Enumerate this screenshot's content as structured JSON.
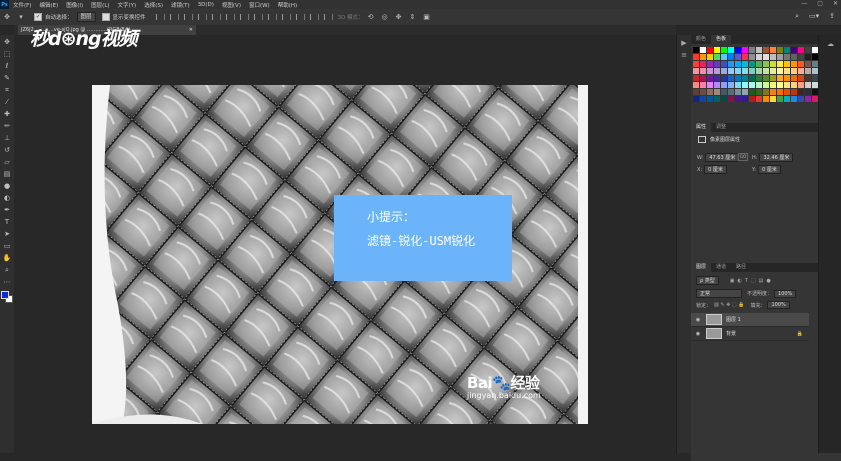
{
  "app": {
    "logo": "Ps"
  },
  "menu": [
    "文件(F)",
    "编辑(E)",
    "图像(I)",
    "图层(L)",
    "文字(Y)",
    "选择(S)",
    "滤镜(T)",
    "3D(D)",
    "视图(V)",
    "窗口(W)",
    "帮助(H)"
  ],
  "window_controls": [
    "—",
    "▢",
    "✕"
  ],
  "options": {
    "auto_select_label": "自动选择：",
    "auto_select_value": "图层",
    "show_transform_label": "显示变换控件",
    "mode_3d_label": "3D 模式："
  },
  "document": {
    "tab_label": "JZ6J2…………ve-sjQ.jpg @ …………(RGB/8#)",
    "close": "✕",
    "add": "+"
  },
  "watermark": "秒d⊛ng视频",
  "tip": {
    "title": "小提示：",
    "body": "滤镜-锐化-USM锐化"
  },
  "baidu_watermark": {
    "main": "Bai🐾经验",
    "sub": "jingyan.baidu.com"
  },
  "swatches_panel": {
    "tabs": [
      "颜色",
      "色板"
    ]
  },
  "properties_panel": {
    "tabs": [
      "属性",
      "调整"
    ],
    "heading": "像素图层属性",
    "w_label": "W:",
    "w_value": "47.63 厘米",
    "h_label": "H:",
    "h_value": "32.46 厘米",
    "link": "GO",
    "x_label": "X:",
    "x_value": "0 厘米",
    "y_label": "Y:",
    "y_value": "0 厘米"
  },
  "layers_panel": {
    "tabs": [
      "图层",
      "通道",
      "路径"
    ],
    "filter_value": "ρ 类型",
    "blend_mode": "正常",
    "opacity_label": "不透明度：",
    "opacity_value": "100%",
    "lock_label": "锁定：",
    "fill_label": "填充：",
    "fill_value": "100%",
    "layers": [
      {
        "name": "图层 1",
        "selected": true
      },
      {
        "name": "背景",
        "selected": false
      }
    ]
  },
  "swatch_colors": [
    "#000000",
    "#ffffff",
    "#ff0000",
    "#ffff00",
    "#00ff00",
    "#00ffff",
    "#0000ff",
    "#ff00ff",
    "#7f7f7f",
    "#c0c0c0",
    "#a0522d",
    "#ff8040",
    "#808000",
    "#008080",
    "#400080",
    "#ff0080",
    "#404040",
    "#ffffff",
    "#ff3b30",
    "#ff9500",
    "#ffcc00",
    "#4cd964",
    "#5ac8fa",
    "#007aff",
    "#5856d6",
    "#ff2d55",
    "#8e8e93",
    "#d1d1d6",
    "#e0e0e0",
    "#bdbdbd",
    "#9e9e9e",
    "#757575",
    "#616161",
    "#424242",
    "#212121",
    "#000000",
    "#f44336",
    "#e91e63",
    "#9c27b0",
    "#673ab7",
    "#3f51b5",
    "#2196f3",
    "#03a9f4",
    "#00bcd4",
    "#009688",
    "#4caf50",
    "#8bc34a",
    "#cddc39",
    "#ffeb3b",
    "#ffc107",
    "#ff9800",
    "#ff5722",
    "#795548",
    "#607d8b",
    "#ef9a9a",
    "#f48fb1",
    "#ce93d8",
    "#b39ddb",
    "#9fa8da",
    "#90caf9",
    "#81d4fa",
    "#80deea",
    "#80cbc4",
    "#a5d6a7",
    "#c5e1a5",
    "#e6ee9c",
    "#fff59d",
    "#ffe082",
    "#ffcc80",
    "#ffab91",
    "#bcaaa4",
    "#b0bec5",
    "#c62828",
    "#ad1457",
    "#6a1b9a",
    "#4527a0",
    "#283593",
    "#1565c0",
    "#0277bd",
    "#00838f",
    "#00695c",
    "#2e7d32",
    "#558b2f",
    "#9e9d24",
    "#f9a825",
    "#ff8f00",
    "#ef6c00",
    "#d84315",
    "#4e342e",
    "#37474f",
    "#ff8a80",
    "#ff80ab",
    "#ea80fc",
    "#b388ff",
    "#8c9eff",
    "#82b1ff",
    "#80d8ff",
    "#84ffff",
    "#a7ffeb",
    "#b9f6ca",
    "#ccff90",
    "#f4ff81",
    "#ffff8d",
    "#ffe57f",
    "#ffd180",
    "#ff9e80",
    "#d7ccc8",
    "#cfd8dc",
    "#5d4037",
    "#6d4c41",
    "#8d6e63",
    "#a1887f",
    "#455a64",
    "#546e7a",
    "#78909c",
    "#90a4ae",
    "#1b5e20",
    "#33691e",
    "#827717",
    "#f57f17",
    "#ff6f00",
    "#e65100",
    "#bf360c",
    "#3e2723",
    "#263238",
    "#111111",
    "#1a237e",
    "#0d47a1",
    "#01579b",
    "#006064",
    "#004d40",
    "#880e4f",
    "#4a148c",
    "#311b92",
    "#b71c1c",
    "#e53935",
    "#fb8c00",
    "#fdd835",
    "#43a047",
    "#00acc1",
    "#1e88e5",
    "#3949ab",
    "#8e24aa",
    "#d81b60"
  ]
}
